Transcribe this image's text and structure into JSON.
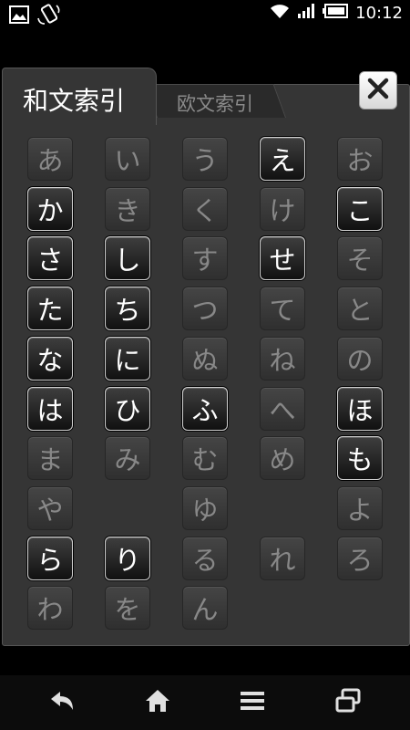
{
  "status_bar": {
    "time": "10:12",
    "icons": [
      "image-notification-icon",
      "screen-rotate-icon",
      "wifi-icon",
      "signal-icon",
      "battery-icon"
    ]
  },
  "tabs": {
    "active_label": "和文索引",
    "inactive_label": "欧文索引"
  },
  "close_label": "×",
  "kana_rows": [
    [
      {
        "k": "あ",
        "on": false
      },
      {
        "k": "い",
        "on": false
      },
      {
        "k": "う",
        "on": false
      },
      {
        "k": "え",
        "on": true
      },
      {
        "k": "お",
        "on": false
      }
    ],
    [
      {
        "k": "か",
        "on": true
      },
      {
        "k": "き",
        "on": false
      },
      {
        "k": "く",
        "on": false
      },
      {
        "k": "け",
        "on": false
      },
      {
        "k": "こ",
        "on": true
      }
    ],
    [
      {
        "k": "さ",
        "on": true
      },
      {
        "k": "し",
        "on": true
      },
      {
        "k": "す",
        "on": false
      },
      {
        "k": "せ",
        "on": true
      },
      {
        "k": "そ",
        "on": false
      }
    ],
    [
      {
        "k": "た",
        "on": true
      },
      {
        "k": "ち",
        "on": true
      },
      {
        "k": "つ",
        "on": false
      },
      {
        "k": "て",
        "on": false
      },
      {
        "k": "と",
        "on": false
      }
    ],
    [
      {
        "k": "な",
        "on": true
      },
      {
        "k": "に",
        "on": true
      },
      {
        "k": "ぬ",
        "on": false
      },
      {
        "k": "ね",
        "on": false
      },
      {
        "k": "の",
        "on": false
      }
    ],
    [
      {
        "k": "は",
        "on": true
      },
      {
        "k": "ひ",
        "on": true
      },
      {
        "k": "ふ",
        "on": true
      },
      {
        "k": "へ",
        "on": false
      },
      {
        "k": "ほ",
        "on": true
      }
    ],
    [
      {
        "k": "ま",
        "on": false
      },
      {
        "k": "み",
        "on": false
      },
      {
        "k": "む",
        "on": false
      },
      {
        "k": "め",
        "on": false
      },
      {
        "k": "も",
        "on": true
      }
    ],
    [
      {
        "k": "や",
        "on": false
      },
      null,
      {
        "k": "ゆ",
        "on": false
      },
      null,
      {
        "k": "よ",
        "on": false
      }
    ],
    [
      {
        "k": "ら",
        "on": true
      },
      {
        "k": "り",
        "on": true
      },
      {
        "k": "る",
        "on": false
      },
      {
        "k": "れ",
        "on": false
      },
      {
        "k": "ろ",
        "on": false
      }
    ],
    [
      {
        "k": "わ",
        "on": false
      },
      {
        "k": "を",
        "on": false
      },
      {
        "k": "ん",
        "on": false
      },
      null,
      null
    ]
  ],
  "nav": [
    "back-icon",
    "home-icon",
    "menu-icon",
    "recent-apps-icon"
  ],
  "colors": {
    "panel": "#353535",
    "key_active_text": "#ffffff",
    "key_inactive_text": "#888888"
  }
}
